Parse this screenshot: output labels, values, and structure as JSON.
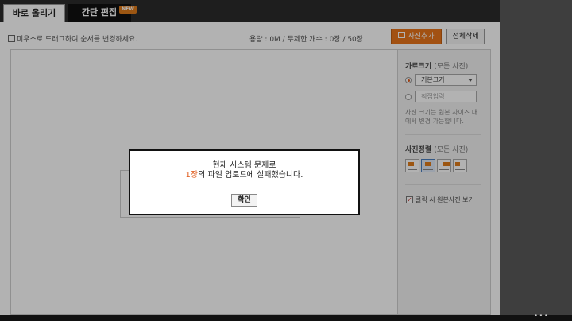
{
  "tabs": {
    "direct_upload": "바로 올리기",
    "quick_edit": "간단 편집",
    "new_badge": "NEW"
  },
  "toolbar": {
    "hint": "미우스로 드래그하여 순서를 변경하세요.",
    "capacity": "용량 : 0M / 무제한 개수 : 0장 / 50장",
    "add_photo": "사진추가",
    "delete_all": "전체삭제"
  },
  "panel": {
    "width_title": "가로크기",
    "width_sub": "(모든 사진)",
    "select_value": "기본크기",
    "direct_input_placeholder": "직접입력",
    "note": "사진 크기는 원본 사이즈 내에서 변경 가능합니다.",
    "align_title": "사진정렬",
    "align_sub": "(모든 사진)",
    "checkbox_label": "클릭 시 원본사진 보기",
    "checkbox_checked": true
  },
  "modal": {
    "line1": "현재 시스템 문제로",
    "line2_highlight": "1장",
    "line2_rest": "의 파일 업로드에 실패했습니다.",
    "ok": "확인"
  },
  "bottom": {
    "dots": "•••"
  },
  "colors": {
    "accent_orange": "#e8751a",
    "highlight": "#e05a1a",
    "tabbar": "#2b2b2b"
  }
}
